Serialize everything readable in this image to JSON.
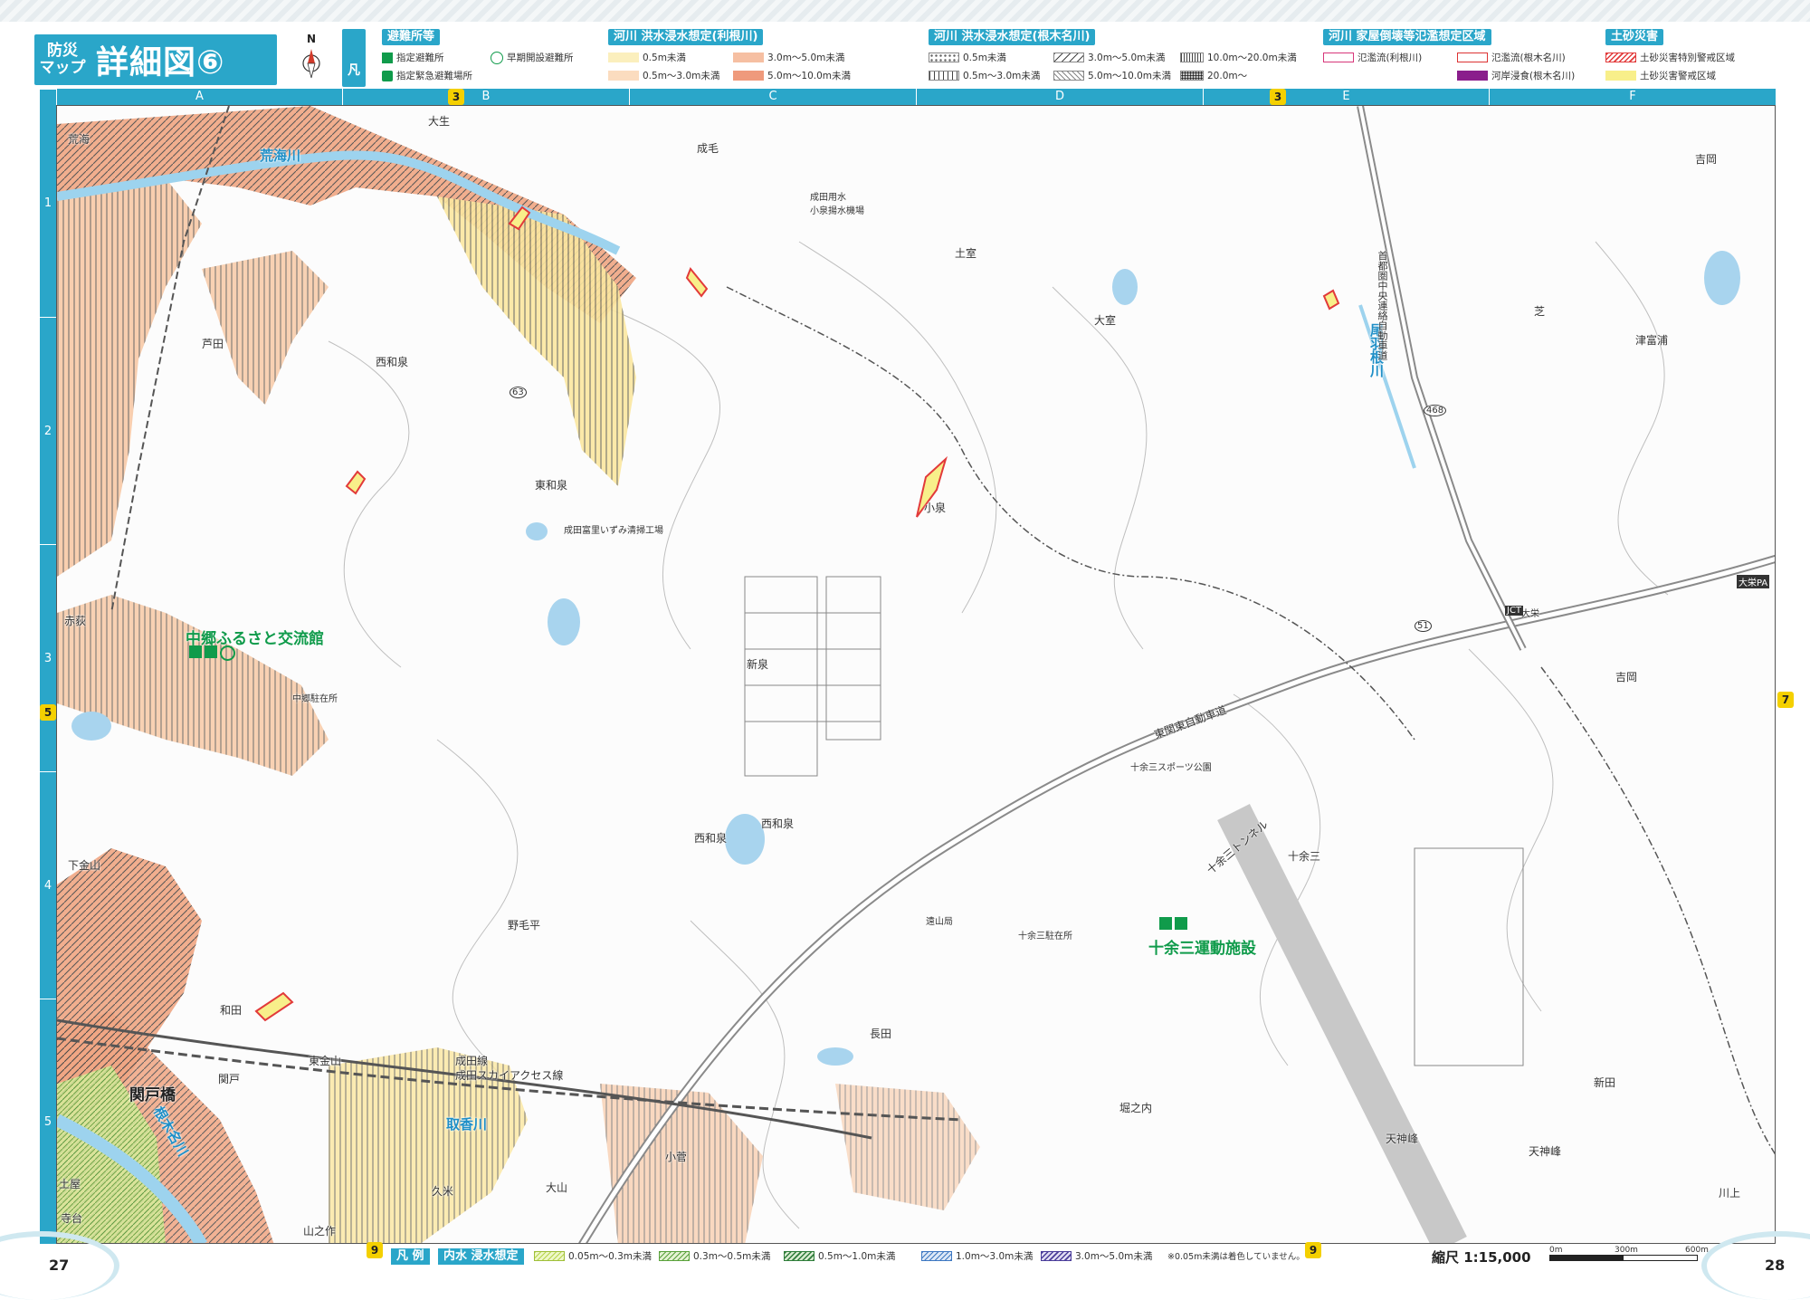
{
  "header": {
    "title_small": "防災\nマップ",
    "title_big": "詳細図⑥",
    "compass_label": "N",
    "legend_vertical": "凡例"
  },
  "legend": {
    "evac": {
      "title": "避難所等",
      "items": [
        "指定避難所",
        "指定緊急避難場所",
        "早期開設避難所"
      ]
    },
    "tone": {
      "title": "河川 洪水浸水想定(利根川)",
      "items": [
        "0.5m未満",
        "0.5m～3.0m未満",
        "3.0m～5.0m未満",
        "5.0m～10.0m未満"
      ]
    },
    "nekina": {
      "title": "河川 洪水浸水想定(根木名川)",
      "items": [
        "0.5m未満",
        "0.5m～3.0m未満",
        "3.0m～5.0m未満",
        "5.0m～10.0m未満",
        "10.0m～20.0m未満",
        "20.0m～"
      ]
    },
    "house": {
      "title": "河川 家屋倒壊等氾濫想定区域",
      "items": [
        "氾濫流(利根川)",
        "氾濫流(根木名川)",
        "河岸浸食(根木名川)"
      ]
    },
    "landslide": {
      "title": "土砂災害",
      "items": [
        "土砂災害特別警戒区域",
        "土砂災害警戒区域"
      ]
    }
  },
  "grid": {
    "columns": [
      "A",
      "B",
      "C",
      "D",
      "E",
      "F"
    ],
    "rows": [
      "1",
      "2",
      "3",
      "4",
      "5"
    ],
    "tags": {
      "top_left": "3",
      "top_right": "3",
      "left": "5",
      "right": "7",
      "bottom_left": "9",
      "bottom_right": "9"
    }
  },
  "map": {
    "rivers": [
      "荒海川",
      "尾羽根川",
      "取香川",
      "根木名川"
    ],
    "facilities": [
      "中郷ふるさと交流館",
      "十余三運動施設"
    ],
    "station": "関戸橋",
    "roads": [
      "東関東自動車道",
      "首都圏中央連絡自動車道",
      "成田線",
      "成田スカイアクセス線",
      "十余三トンネル"
    ],
    "places": [
      "荒海",
      "大生",
      "成毛",
      "土室",
      "芝",
      "吉岡",
      "芦田",
      "西和泉",
      "大室",
      "津富浦",
      "東和泉",
      "小泉",
      "赤荻",
      "新泉",
      "吉岡",
      "西和泉",
      "西和泉",
      "十余三",
      "下金山",
      "野毛平",
      "和田",
      "長田",
      "東金山",
      "関戸",
      "堀之内",
      "天神峰",
      "天神峰",
      "新田",
      "川上",
      "土屋",
      "寺台",
      "久米",
      "大山",
      "小菅",
      "山之作"
    ],
    "poi": [
      "成田用水\n小泉揚水機場",
      "成田富里いずみ清掃工場",
      "中郷駐在所",
      "十余三スポーツ公園",
      "十余三駐在所",
      "遠山局",
      "大栄",
      "大栄PA",
      "JCT"
    ],
    "route_numbers": [
      "63",
      "468",
      "51"
    ]
  },
  "footer": {
    "page_left": "27",
    "page_right": "28",
    "legend_title": "凡 例",
    "inland_title": "内水 浸水想定",
    "inland_items": [
      "0.05m～0.3m未満",
      "0.3m～0.5m未満",
      "0.5m～1.0m未満",
      "1.0m～3.0m未満",
      "3.0m～5.0m未満"
    ],
    "note": "※0.05m未満は着色していません。",
    "scale_text": "縮尺 1:15,000",
    "scale_ticks": [
      "0m",
      "300m",
      "600m"
    ]
  }
}
